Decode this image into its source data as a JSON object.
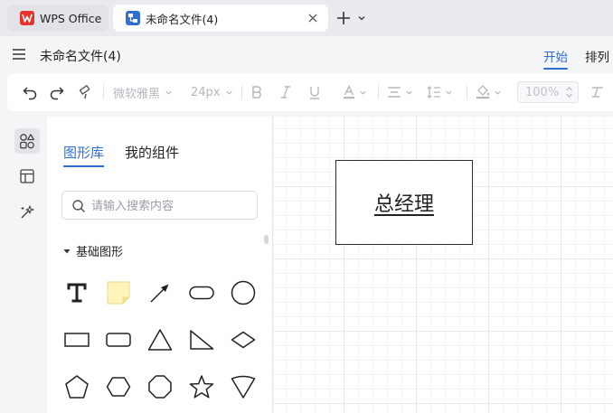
{
  "tabs": [
    {
      "label": "WPS Office",
      "icon": "wps-logo-icon",
      "brand_color": "#e8332d"
    },
    {
      "label": "未命名文件(4)",
      "icon": "diagram-file-icon",
      "brand_color": "#2f6fd6",
      "active": true
    }
  ],
  "menubar": {
    "doc_title": "未命名文件(4)",
    "tabs": [
      {
        "label": "开始",
        "active": true
      },
      {
        "label": "排列"
      }
    ]
  },
  "toolbar": {
    "font_family": "微软雅黑",
    "font_size": "24px",
    "zoom": "100%"
  },
  "panel": {
    "tabs": [
      {
        "label": "图形库",
        "active": true
      },
      {
        "label": "我的组件"
      }
    ],
    "search_placeholder": "请输入搜索内容",
    "section_title": "基础图形",
    "shapes": [
      "text",
      "note",
      "arrow",
      "rounded-rectangle",
      "circle",
      "rectangle",
      "rounded-rect-small",
      "triangle",
      "right-triangle",
      "diamond",
      "pentagon",
      "hexagon",
      "octagon",
      "star",
      "funnel"
    ]
  },
  "canvas": {
    "node_text": "总经理"
  },
  "colors": {
    "accent": "#2f6fd6",
    "wps_red": "#e8332d"
  }
}
